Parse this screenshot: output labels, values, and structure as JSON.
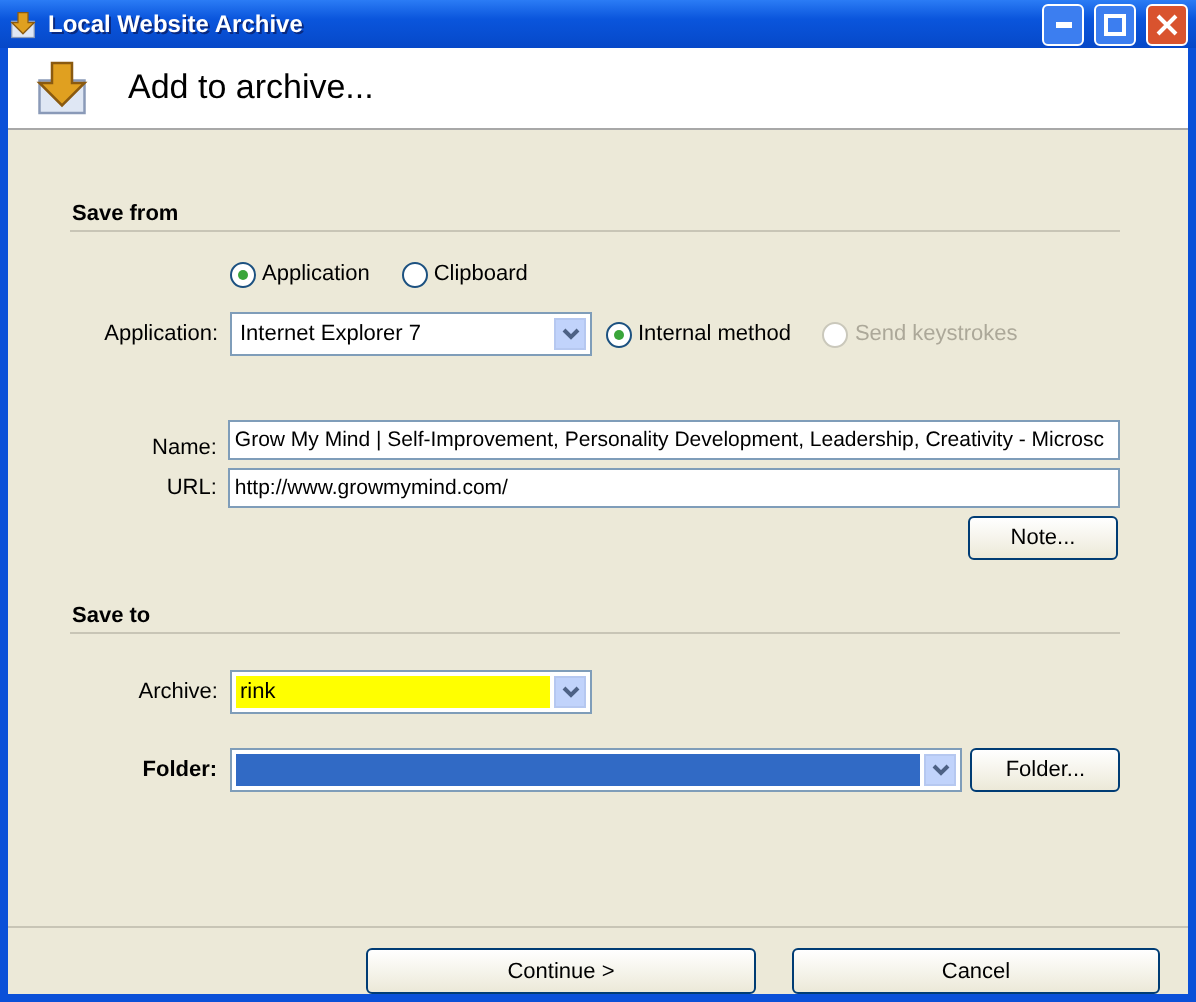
{
  "window": {
    "title": "Local Website Archive"
  },
  "header": {
    "title": "Add to archive..."
  },
  "save_from": {
    "heading": "Save from",
    "source_options": [
      {
        "label": "Application",
        "selected": true
      },
      {
        "label": "Clipboard",
        "selected": false
      }
    ],
    "application": {
      "label": "Application:",
      "value": "Internet Explorer 7"
    },
    "method_options": [
      {
        "label": "Internal method",
        "selected": true,
        "disabled": false
      },
      {
        "label": "Send keystrokes",
        "selected": false,
        "disabled": true
      }
    ],
    "name": {
      "label": "Name:",
      "value": "Grow My Mind | Self-Improvement, Personality Development, Leadership, Creativity - Microsc"
    },
    "url": {
      "label": "URL:",
      "value": "http://www.growmymind.com/"
    },
    "note_button": "Note..."
  },
  "save_to": {
    "heading": "Save to",
    "archive": {
      "label": "Archive:",
      "value": "rink",
      "highlighted": true
    },
    "folder": {
      "label": "Folder:",
      "selected": true
    },
    "folder_button": "Folder..."
  },
  "buttons": [
    "Continue >",
    "Cancel"
  ]
}
